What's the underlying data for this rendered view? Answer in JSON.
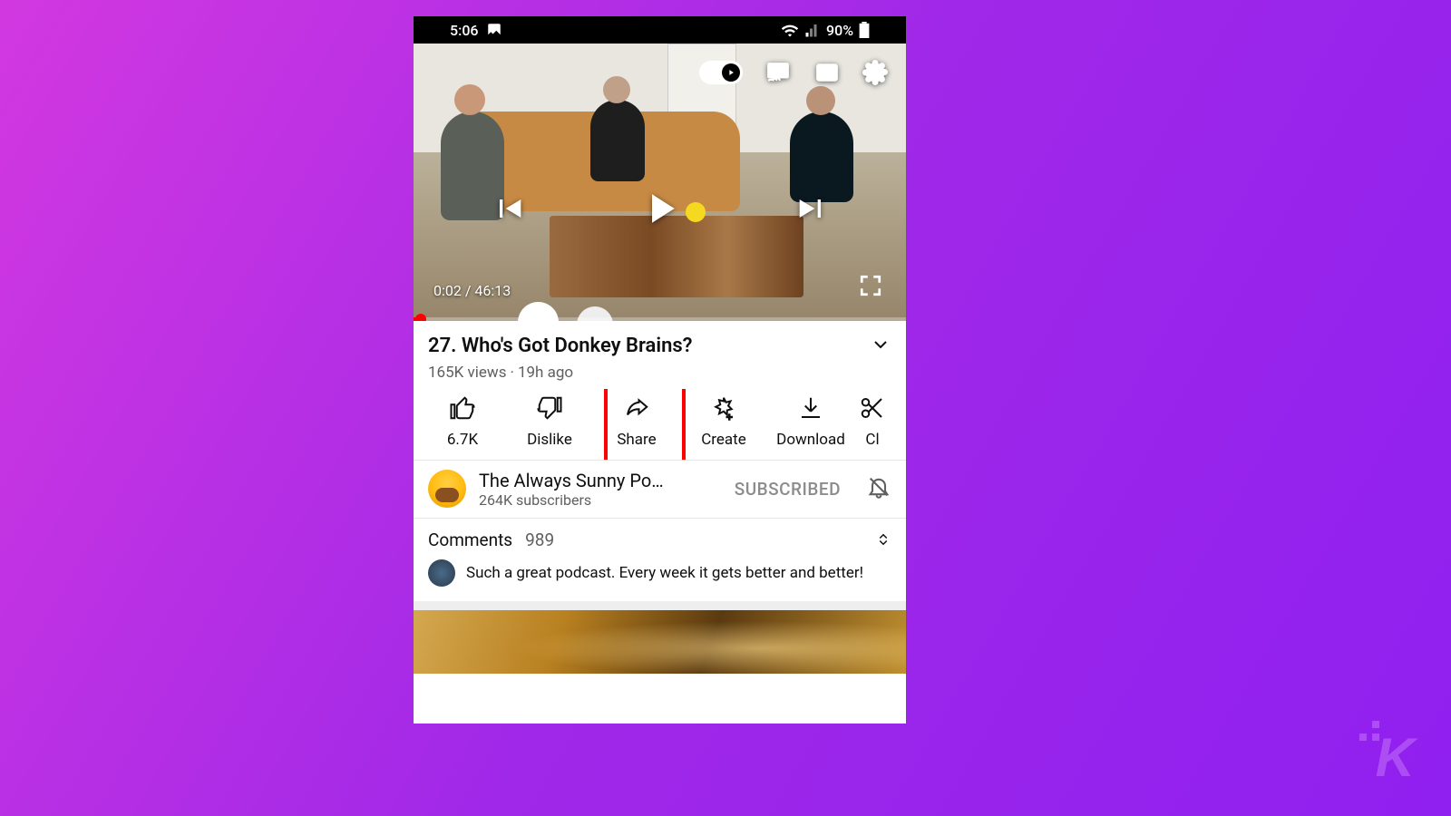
{
  "statusbar": {
    "time": "5:06",
    "battery_pct": "90%"
  },
  "player": {
    "elapsed": "0:02",
    "duration": "46:13",
    "time_display": "0:02 / 46:13"
  },
  "video": {
    "title": "27. Who's Got Donkey Brains?",
    "views": "165K views",
    "age": "19h ago"
  },
  "actions": {
    "like": {
      "label": "6.7K"
    },
    "dislike": {
      "label": "Dislike"
    },
    "share": {
      "label": "Share"
    },
    "create": {
      "label": "Create"
    },
    "download": {
      "label": "Download"
    },
    "clip": {
      "label": "Cl"
    }
  },
  "channel": {
    "name": "The Always Sunny Po…",
    "subs": "264K subscribers",
    "status": "SUBSCRIBED"
  },
  "comments": {
    "label": "Comments",
    "count": "989",
    "top": {
      "text": "Such a great podcast. Every week it gets better and better!"
    }
  }
}
